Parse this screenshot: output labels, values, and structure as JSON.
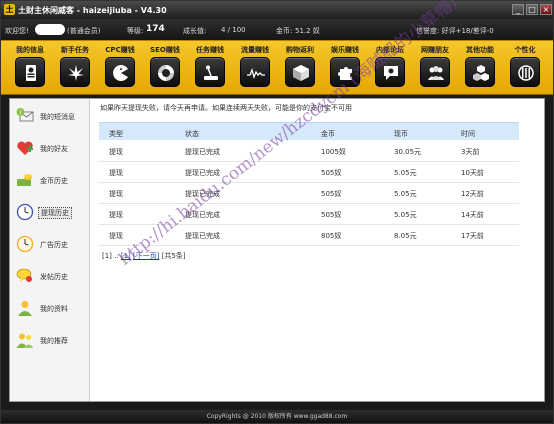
{
  "titlebar": {
    "title": "土财主休闲威客 - haizeijiuba - V4.30",
    "icon": "app-logo-icon",
    "minimize": "_",
    "maximize": "□",
    "close": "×"
  },
  "status": {
    "welcome": "欢迎您!",
    "member_type": "(普通会员)",
    "level_label": "等级:",
    "level_value": "174",
    "growth_label": "成长值:",
    "growth_value": "4 / 100",
    "gold_label": "金币:",
    "gold_value": "51.2 奴",
    "credit": "信誉度: 好评+18/差评-0"
  },
  "nav": [
    {
      "label": "我的信息",
      "icon": "profile-card-icon"
    },
    {
      "label": "新手任务",
      "icon": "leaf-icon"
    },
    {
      "label": "CPC赚钱",
      "icon": "pacman-icon"
    },
    {
      "label": "SEO赚钱",
      "icon": "swirl-icon"
    },
    {
      "label": "任务赚钱",
      "icon": "joystick-icon"
    },
    {
      "label": "流量赚钱",
      "icon": "wave-graph-icon"
    },
    {
      "label": "购物返利",
      "icon": "box-icon"
    },
    {
      "label": "娱乐赚钱",
      "icon": "puzzle-icon"
    },
    {
      "label": "内部论坛",
      "icon": "chat-bubble-icon"
    },
    {
      "label": "网赚朋友",
      "icon": "people-icon"
    },
    {
      "label": "其他功能",
      "icon": "cubes-icon"
    },
    {
      "label": "个性化",
      "icon": "settings-dial-icon"
    }
  ],
  "sidebar": [
    {
      "label": "我的短消息",
      "icon": "message-icon"
    },
    {
      "label": "我的好友",
      "icon": "friend-heart-icon"
    },
    {
      "label": "金币历史",
      "icon": "gold-coins-icon"
    },
    {
      "label": "提现历史",
      "icon": "clock-icon"
    },
    {
      "label": "广告历史",
      "icon": "ad-clock-icon"
    },
    {
      "label": "发帖历史",
      "icon": "post-chat-icon"
    },
    {
      "label": "我的资料",
      "icon": "user-icon"
    },
    {
      "label": "我的推荐",
      "icon": "users-referral-icon"
    }
  ],
  "main": {
    "notice": "如果昨天提现失败，请今天再申请。如果连续两天失败，可能是你的支付宝不可用",
    "columns": [
      "类型",
      "状态",
      "金币",
      "现币",
      "时间"
    ],
    "rows": [
      [
        "提现",
        "提现已完成",
        "1005奴",
        "30.05元",
        "3天前"
      ],
      [
        "提现",
        "提现已完成",
        "505奴",
        "5.05元",
        "10天前"
      ],
      [
        "提现",
        "提现已完成",
        "505奴",
        "5.05元",
        "12天前"
      ],
      [
        "提现",
        "提现已完成",
        "505奴",
        "5.05元",
        "14天前"
      ],
      [
        "提现",
        "提现已完成",
        "805奴",
        "8.05元",
        "17天前"
      ]
    ],
    "pager": {
      "current": "[1]",
      "ellipsis": "..",
      "page_link": "[1]",
      "next": "[下一页]",
      "total": "[共5条]"
    }
  },
  "footer": "CopyRights @ 2010 版权所有 www.ggad88.com",
  "watermark": "http://hi.baidu.com/new/hzcdycm (海贼船的小草帽)",
  "colors": {
    "nav_bg": "#f0b810",
    "table_header": "#d5e9fb",
    "chrome": "#1a1a1a"
  }
}
